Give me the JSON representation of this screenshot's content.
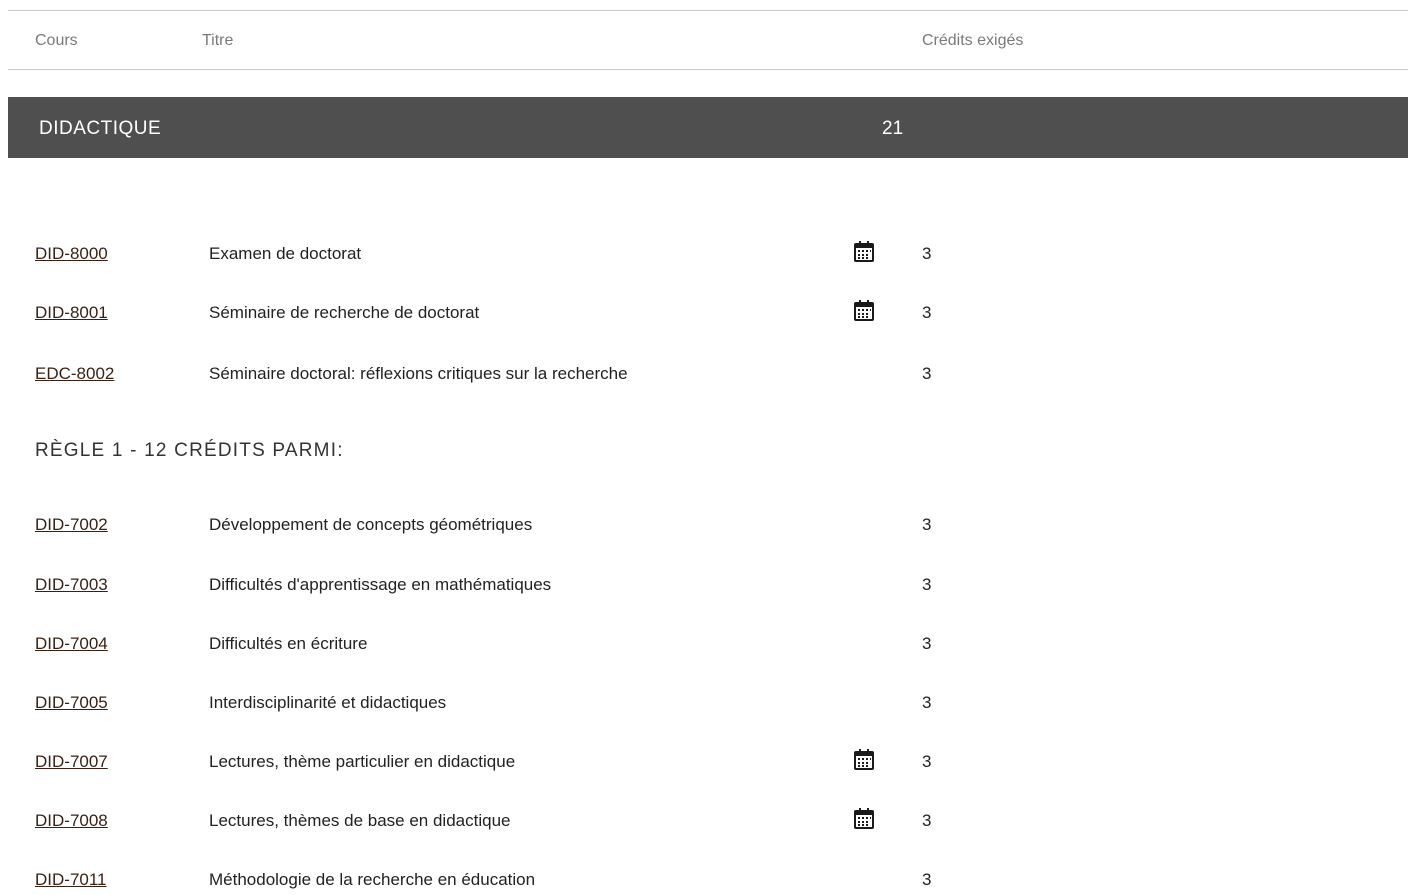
{
  "table_header": {
    "cours": "Cours",
    "titre": "Titre",
    "credits": "Crédits exigés"
  },
  "section": {
    "title": "DIDACTIQUE",
    "credits": "21"
  },
  "courses": [
    {
      "code": "DID-8000",
      "title": "Examen de doctorat",
      "credits": "3",
      "calendar_icon": true
    },
    {
      "code": "DID-8001",
      "title": "Séminaire de recherche de doctorat",
      "credits": "3",
      "calendar_icon": true
    },
    {
      "code": "EDC-8002",
      "title": "Séminaire doctoral: réflexions critiques sur la recherche",
      "credits": "3",
      "calendar_icon": false
    }
  ],
  "rule": {
    "heading": "RÈGLE 1 - 12 CRÉDITS PARMI:"
  },
  "rule_courses": [
    {
      "code": "DID-7002",
      "title": "Développement de concepts géométriques",
      "credits": "3",
      "calendar_icon": false
    },
    {
      "code": "DID-7003",
      "title": "Difficultés d'apprentissage en mathématiques",
      "credits": "3",
      "calendar_icon": false
    },
    {
      "code": "DID-7004",
      "title": "Difficultés en écriture",
      "credits": "3",
      "calendar_icon": false
    },
    {
      "code": "DID-7005",
      "title": "Interdisciplinarité et didactiques",
      "credits": "3",
      "calendar_icon": false
    },
    {
      "code": "DID-7007",
      "title": "Lectures, thème particulier en didactique",
      "credits": "3",
      "calendar_icon": true
    },
    {
      "code": "DID-7008",
      "title": "Lectures, thèmes de base en didactique",
      "credits": "3",
      "calendar_icon": true
    },
    {
      "code": "DID-7011",
      "title": "Méthodologie de la recherche en éducation",
      "credits": "3",
      "calendar_icon": false
    }
  ],
  "icons": {
    "calendar": "calendar-icon"
  },
  "colors": {
    "section_bar": "#4f4f4f",
    "link": "#3a1f12",
    "header_text": "#7a7a7a"
  }
}
